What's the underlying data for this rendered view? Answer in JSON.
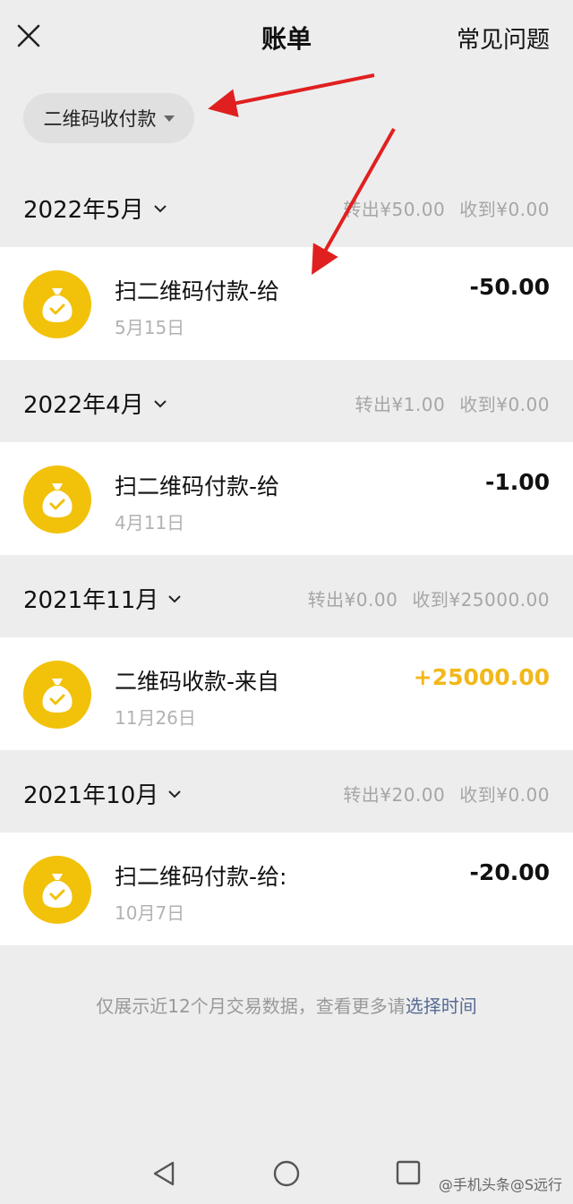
{
  "header": {
    "title": "账单",
    "faq_label": "常见问题"
  },
  "filter": {
    "label": "二维码收付款"
  },
  "months": [
    {
      "label": "2022年5月",
      "out": "转出¥50.00",
      "in": "收到¥0.00",
      "transaction": {
        "title": "扫二维码付款-给",
        "date": "5月15日",
        "amount": "-50.00"
      }
    },
    {
      "label": "2022年4月",
      "out": "转出¥1.00",
      "in": "收到¥0.00",
      "transaction": {
        "title": "扫二维码付款-给",
        "date": "4月11日",
        "amount": "-1.00"
      }
    },
    {
      "label": "2021年11月",
      "out": "转出¥0.00",
      "in": "收到¥25000.00",
      "transaction": {
        "title": "二维码收款-来自",
        "date": "11月26日",
        "amount": "+25000.00"
      }
    },
    {
      "label": "2021年10月",
      "out": "转出¥20.00",
      "in": "收到¥0.00",
      "transaction": {
        "title": "扫二维码付款-给:",
        "date": "10月7日",
        "amount": "-20.00"
      }
    }
  ],
  "footer": {
    "text": "仅展示近12个月交易数据，查看更多请",
    "link": "选择时间"
  },
  "watermark": "@手机头条@S远行",
  "colors": {
    "accent_yellow": "#f2c10a",
    "income": "#f2b81a",
    "link": "#576b95",
    "annotation_arrow": "#e02020"
  },
  "icons": [
    "close-icon",
    "chevron-down-icon",
    "money-bag-icon",
    "back-triangle-icon",
    "home-circle-icon",
    "recent-square-icon"
  ]
}
